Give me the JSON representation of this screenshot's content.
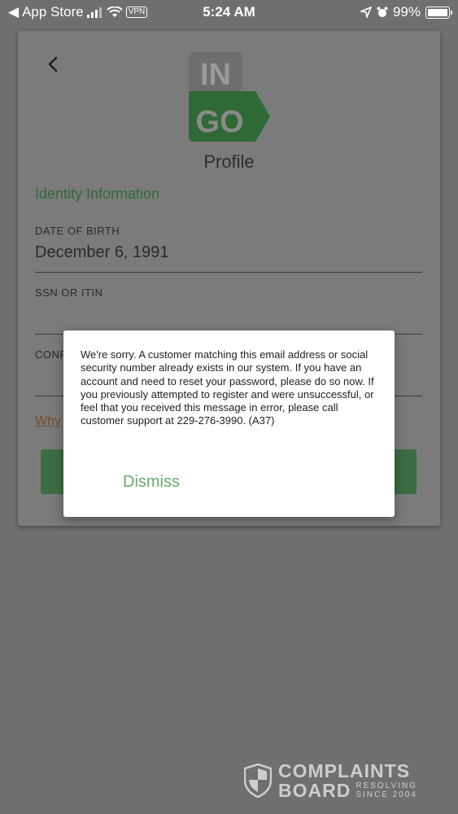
{
  "status_bar": {
    "back_app": "App Store",
    "vpn": "VPN",
    "time": "5:24 AM",
    "battery": "99%",
    "battery_level": 0.99
  },
  "logo": {
    "top": "IN",
    "bottom": "GO",
    "colors": {
      "top": "#6e6e6e",
      "bottom": "#2f6a36"
    }
  },
  "header": {
    "title": "Profile"
  },
  "section": {
    "title": "Identity Information"
  },
  "fields": {
    "dob": {
      "label": "DATE OF BIRTH",
      "value": "December 6, 1991"
    },
    "ssn": {
      "label": "SSN OR ITIN",
      "value": ""
    },
    "confirm": {
      "label": "CONF",
      "value": ""
    }
  },
  "why_link": "Why",
  "dialog": {
    "message": "We're sorry. A customer matching this email address or social security number already exists in our system. If you have an account and need to reset your password, please do so now. If you previously attempted to register and were unsuccessful, or feel that you received this message in error, please call customer support at 229-276-3990. (A37)",
    "dismiss": "Dismiss"
  },
  "watermark": {
    "line1": "COMPLAINTS",
    "line2": "BOARD",
    "tag1": "RESOLVING",
    "tag2": "SINCE 2004"
  },
  "colors": {
    "accent_green": "#2e6b36",
    "dismiss_green": "#6aaa6a",
    "overlay": "#6f6f6f"
  }
}
